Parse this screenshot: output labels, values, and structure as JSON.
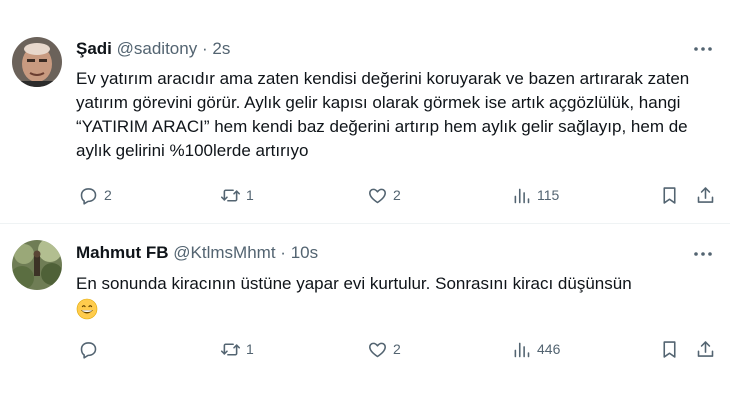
{
  "tweets": [
    {
      "name": "Şadi",
      "handle": "@saditony",
      "dot": "·",
      "time": "2s",
      "text": "Ev yatırım aracıdır ama zaten kendisi değerini koruyarak ve bazen artırarak zaten yatırım görevini görür. Aylık gelir kapısı olarak görmek ise artık açgözlülük, hangi “YATIRIM ARACI” hem kendi baz değerini artırıp hem aylık gelir sağlayıp, hem de aylık gelirini %100lerde artırıyo",
      "emoji": "",
      "replies": "2",
      "retweets": "1",
      "likes": "2",
      "views": "115"
    },
    {
      "name": "Mahmut FB",
      "handle": "@KtlmsMhmt",
      "dot": "·",
      "time": "10s",
      "text": "En sonunda kiracının üstüne yapar evi kurtulur. Sonrasını kiracı düşünsün",
      "emoji": "grinning-face-emoji",
      "replies": "",
      "retweets": "1",
      "likes": "2",
      "views": "446"
    }
  ],
  "icons": {
    "reply": "reply-icon",
    "retweet": "retweet-icon",
    "like": "heart-icon",
    "views": "views-icon",
    "bookmark": "bookmark-icon",
    "share": "share-icon",
    "more": "more-icon"
  },
  "colors": {
    "text": "#0f1419",
    "secondary": "#536471",
    "divider": "#eff3f4"
  }
}
